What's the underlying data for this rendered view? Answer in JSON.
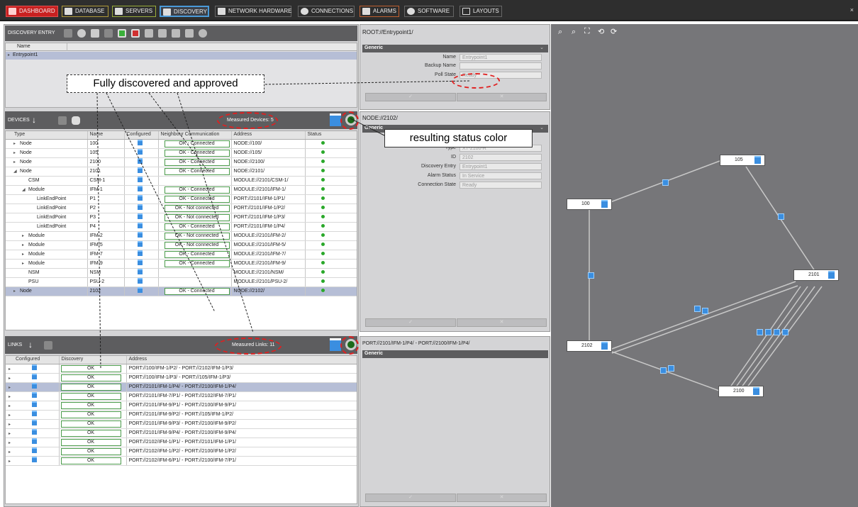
{
  "nav": {
    "tabs": [
      {
        "label": "DASHBOARD",
        "icon": "dashboard-icon",
        "color": "#e03030"
      },
      {
        "label": "DATABASE",
        "icon": "database-icon",
        "color": "#c0a030"
      },
      {
        "label": "SERVERS",
        "icon": "servers-icon",
        "color": "#a0b040"
      },
      {
        "label": "DISCOVERY",
        "icon": "discovery-icon",
        "color": "#4a9ad8"
      },
      {
        "label": "NETWORK HARDWARE",
        "icon": "network-hardware-icon",
        "color": "#777"
      },
      {
        "label": "CONNECTIONS",
        "icon": "connections-icon",
        "color": "#777"
      },
      {
        "label": "ALARMS",
        "icon": "alarm-icon",
        "color": "#c06030"
      },
      {
        "label": "SOFTWARE",
        "icon": "software-icon",
        "color": "#777"
      },
      {
        "label": "LAYOUTS",
        "icon": "layouts-icon",
        "color": "#777"
      }
    ],
    "close": "×"
  },
  "discovery": {
    "title": "DISCOVERY ENTRY",
    "col_name": "Name",
    "row": "Entrypoint1"
  },
  "devices": {
    "title": "DEVICES",
    "measured": "Measured Devices: 5",
    "columns": [
      "Type",
      "Name",
      "Configured",
      "Neighbour Communication",
      "Address",
      "Status"
    ],
    "rows": [
      {
        "type": "Node",
        "name": "100",
        "comm": "OK - Connected",
        "addr": "NODE://100/"
      },
      {
        "type": "Node",
        "name": "105",
        "comm": "OK - Connected",
        "addr": "NODE://105/"
      },
      {
        "type": "Node",
        "name": "2100",
        "comm": "OK - Connected",
        "addr": "NODE://2100/"
      },
      {
        "type": "Node",
        "name": "2101",
        "comm": "OK - Connected",
        "addr": "NODE://2101/"
      },
      {
        "type": "CSM",
        "name": "CSM-1",
        "comm": "",
        "addr": "MODULE://2101/CSM-1/"
      },
      {
        "type": "Module",
        "name": "IFM-1",
        "comm": "OK - Connected",
        "addr": "MODULE://2101/IFM-1/"
      },
      {
        "type": "LinkEndPoint",
        "name": "P1",
        "comm": "OK - Connected",
        "addr": "PORT://2101/IFM-1/P1/"
      },
      {
        "type": "LinkEndPoint",
        "name": "P2",
        "comm": "OK - Not connected",
        "addr": "PORT://2101/IFM-1/P2/"
      },
      {
        "type": "LinkEndPoint",
        "name": "P3",
        "comm": "OK - Not connected",
        "addr": "PORT://2101/IFM-1/P3/"
      },
      {
        "type": "LinkEndPoint",
        "name": "P4",
        "comm": "OK - Connected",
        "addr": "PORT://2101/IFM-1/P4/"
      },
      {
        "type": "Module",
        "name": "IFM-2",
        "comm": "OK - Not connected",
        "addr": "MODULE://2101/IFM-2/"
      },
      {
        "type": "Module",
        "name": "IFM-5",
        "comm": "OK - Not connected",
        "addr": "MODULE://2101/IFM-5/"
      },
      {
        "type": "Module",
        "name": "IFM-7",
        "comm": "OK - Connected",
        "addr": "MODULE://2101/IFM-7/"
      },
      {
        "type": "Module",
        "name": "IFM-9",
        "comm": "OK - Connected",
        "addr": "MODULE://2101/IFM-9/"
      },
      {
        "type": "NSM",
        "name": "NSM",
        "comm": "",
        "addr": "MODULE://2101/NSM/"
      },
      {
        "type": "PSU",
        "name": "PSU-2",
        "comm": "",
        "addr": "MODULE://2101/PSU-2/"
      },
      {
        "type": "Node",
        "name": "2102",
        "comm": "OK - Connected",
        "addr": "NODE://2102/"
      }
    ]
  },
  "links": {
    "title": "LINKS",
    "measured": "Measured Links: 11",
    "columns": [
      "Configured",
      "Discovery",
      "Address"
    ],
    "rows": [
      {
        "disc": "OK",
        "addr": "PORT://100/IFM-1/P2/ - PORT://2102/IFM-1/P3/"
      },
      {
        "disc": "OK",
        "addr": "PORT://100/IFM-1/P3/ - PORT://105/IFM-1/P3/"
      },
      {
        "disc": "OK",
        "addr": "PORT://2101/IFM-1/P4/ - PORT://2100/IFM-1/P4/"
      },
      {
        "disc": "OK",
        "addr": "PORT://2101/IFM-7/P1/ - PORT://2102/IFM-7/P1/"
      },
      {
        "disc": "OK",
        "addr": "PORT://2101/IFM-9/P1/ - PORT://2100/IFM-9/P1/"
      },
      {
        "disc": "OK",
        "addr": "PORT://2101/IFM-9/P2/ - PORT://105/IFM-1/P2/"
      },
      {
        "disc": "OK",
        "addr": "PORT://2101/IFM-9/P3/ - PORT://2100/IFM-9/P2/"
      },
      {
        "disc": "OK",
        "addr": "PORT://2101/IFM-9/P4/ - PORT://2100/IFM-9/P4/"
      },
      {
        "disc": "OK",
        "addr": "PORT://2102/IFM-1/P1/ - PORT://2101/IFM-1/P1/"
      },
      {
        "disc": "OK",
        "addr": "PORT://2102/IFM-1/P2/ - PORT://2100/IFM-1/P2/"
      },
      {
        "disc": "OK",
        "addr": "PORT://2102/IFM-6/P1/ - PORT://2100/IFM-7/P1/"
      }
    ]
  },
  "prop1": {
    "path": "ROOT://Entrypoint1/",
    "section": "Generic",
    "fields": [
      {
        "label": "Name",
        "value": "Entrypoint1"
      },
      {
        "label": "Backup Name",
        "value": ""
      },
      {
        "label": "Poll State",
        "value": "Ready"
      }
    ],
    "ok": "✓",
    "cancel": "✕"
  },
  "prop2": {
    "path": "NODE://2102/",
    "section": "Generic",
    "fields": [
      {
        "label": "Type",
        "value": "XT-2100-R"
      },
      {
        "label": "ID",
        "value": "2102"
      },
      {
        "label": "Discovery Entry",
        "value": "Entrypoint1"
      },
      {
        "label": "Alarm Status",
        "value": "In Service"
      },
      {
        "label": "Connection State",
        "value": "Ready"
      }
    ],
    "ok": "✓",
    "cancel": "✕"
  },
  "prop3": {
    "path": "PORT://2101/IFM-1/P4/ - PORT://2100/IFM-1/P4/",
    "section": "Generic",
    "ok": "✓",
    "cancel": "✕"
  },
  "network": {
    "nodes": [
      "105",
      "100",
      "2101",
      "2102",
      "2100"
    ]
  },
  "annotations": {
    "approved": "Fully discovered and approved",
    "status_color": "resulting status color"
  },
  "colors": {
    "ok": "#2aa82a",
    "accent": "#3a8ee0",
    "highlight": "#e02020"
  }
}
